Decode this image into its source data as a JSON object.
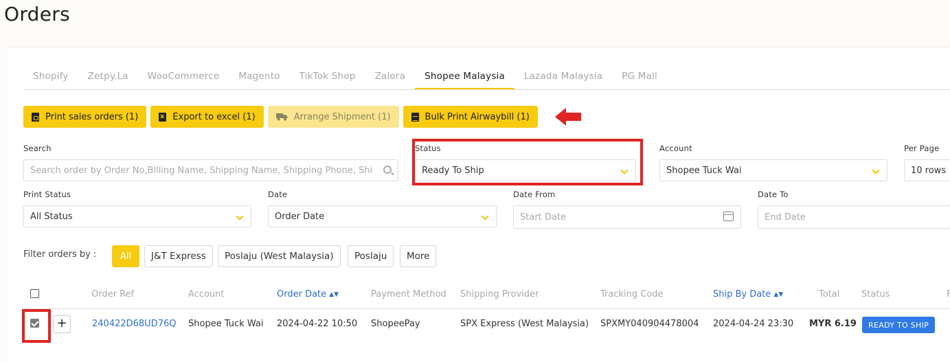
{
  "page": {
    "title": "Orders"
  },
  "tabs": [
    "Shopify",
    "Zetpy.La",
    "WooCommerce",
    "Magento",
    "TikTok Shop",
    "Zalora",
    "Shopee Malaysia",
    "Lazada Malaysia",
    "PG Mall"
  ],
  "active_tab": "Shopee Malaysia",
  "actions": {
    "print_sales": "Print sales orders (1)",
    "export_excel": "Export to excel (1)",
    "arrange_shipment": "Arrange Shipment (1)",
    "bulk_print": "Bulk Print Airwaybill (1)"
  },
  "filters": {
    "search": {
      "label": "Search",
      "placeholder": "Search order by Order No,Billing Name, Shipping Name, Shipping Phone, Shi"
    },
    "status": {
      "label": "Status",
      "value": "Ready To Ship"
    },
    "account": {
      "label": "Account",
      "value": "Shopee Tuck Wai"
    },
    "per_page": {
      "label": "Per Page",
      "value": "10 rows"
    },
    "print_status": {
      "label": "Print Status",
      "value": "All Status"
    },
    "date": {
      "label": "Date",
      "value": "Order Date"
    },
    "date_from": {
      "label": "Date From",
      "placeholder": "Start Date"
    },
    "date_to": {
      "label": "Date To",
      "placeholder": "End Date"
    }
  },
  "filter_orders": {
    "label": "Filter orders by :",
    "chips": [
      "All",
      "J&T Express",
      "Poslaju (West Malaysia)",
      "Poslaju",
      "More"
    ]
  },
  "table": {
    "headers": {
      "order_ref": "Order Ref",
      "account": "Account",
      "order_date": "Order Date",
      "payment_method": "Payment Method",
      "shipping_provider": "Shipping Provider",
      "tracking_code": "Tracking Code",
      "ship_by_date": "Ship By Date",
      "total": "Total",
      "status": "Status",
      "overflow": "F"
    },
    "rows": [
      {
        "order_ref": "240422D68UD76Q",
        "account": "Shopee Tuck Wai",
        "order_date": "2024-04-22 10:50",
        "payment_method": "ShopeePay",
        "shipping_provider": "SPX Express (West Malaysia)",
        "tracking_code": "SPXMY040904478004",
        "ship_by_date": "2024-04-24 23:30",
        "total": "MYR 6.19",
        "status": "READY TO SHIP",
        "selected": true
      }
    ]
  },
  "colors": {
    "accent": "#f7cb10",
    "link": "#2f6fd0",
    "badge": "#2f7ae5",
    "highlight": "#e02424"
  }
}
